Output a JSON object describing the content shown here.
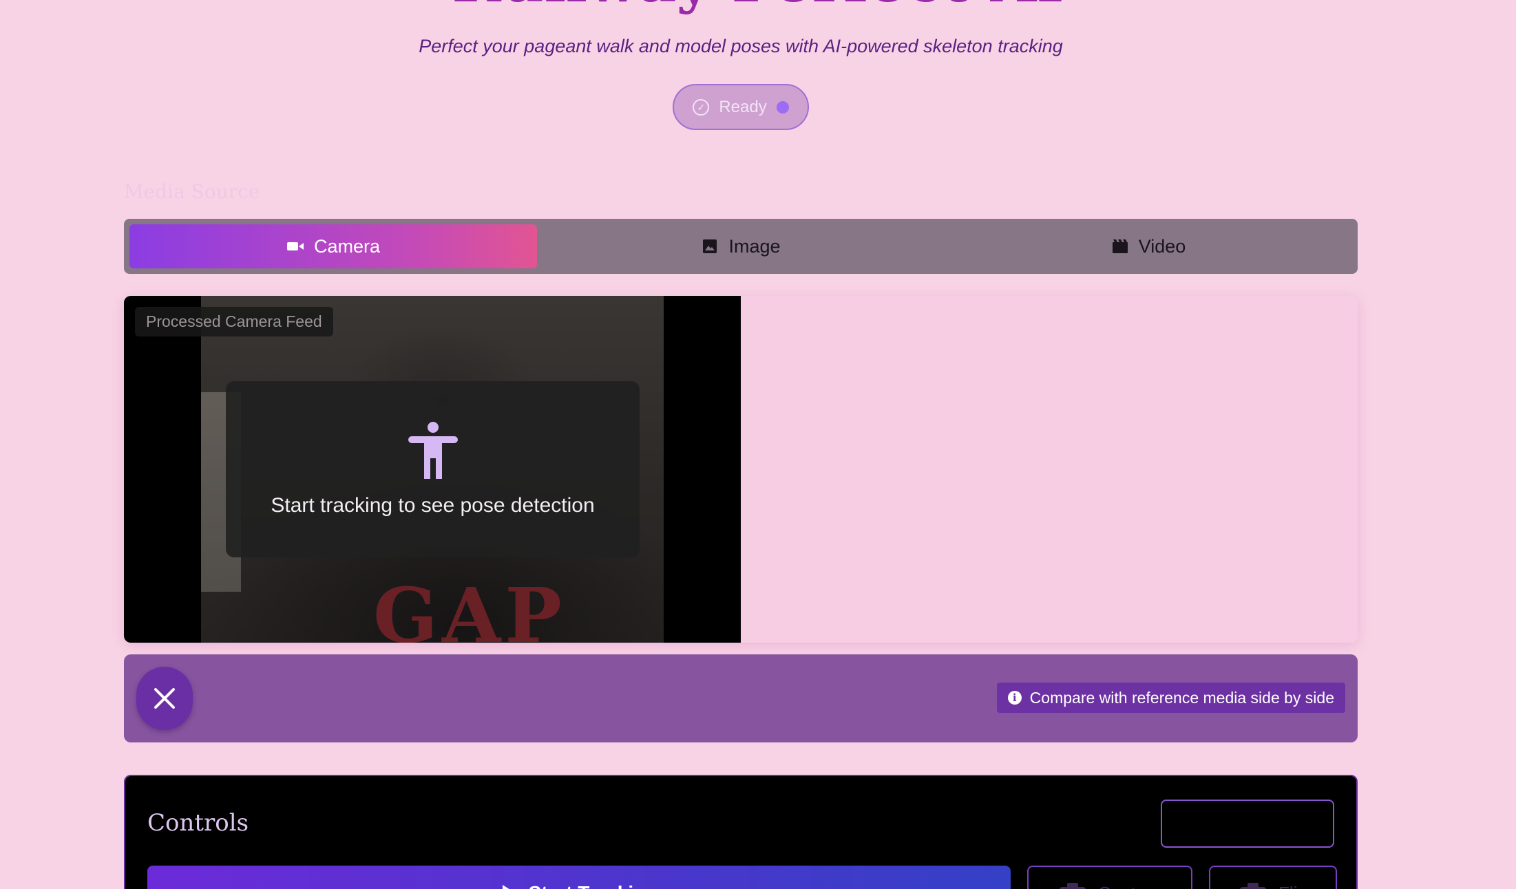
{
  "header": {
    "title": "Runway Perfect AI",
    "subtitle": "Perfect your pageant walk and model poses with AI-powered skeleton tracking",
    "status": "Ready"
  },
  "source": {
    "label": "Media Source",
    "tabs": [
      {
        "label": "Camera",
        "icon": "videocam-icon",
        "active": true
      },
      {
        "label": "Image",
        "icon": "image-icon",
        "active": false
      },
      {
        "label": "Video",
        "icon": "movie-icon",
        "active": false
      }
    ]
  },
  "feed": {
    "label": "Processed Camera Feed",
    "overlay_text": "Start tracking to see pose detection",
    "shirt_text": "GAP"
  },
  "actionbar": {
    "compare_hint": "Compare with reference media side by side"
  },
  "controls": {
    "title": "Controls",
    "start_label": "Start Tracking",
    "capture_label": "Capture",
    "flip_label": "Flip"
  },
  "colors": {
    "background": "#f8d3e5",
    "title": "#9a2aa8",
    "accent": "#6c31a2",
    "tab_gradient_start": "#8b3de3",
    "tab_gradient_end": "#e25593"
  }
}
